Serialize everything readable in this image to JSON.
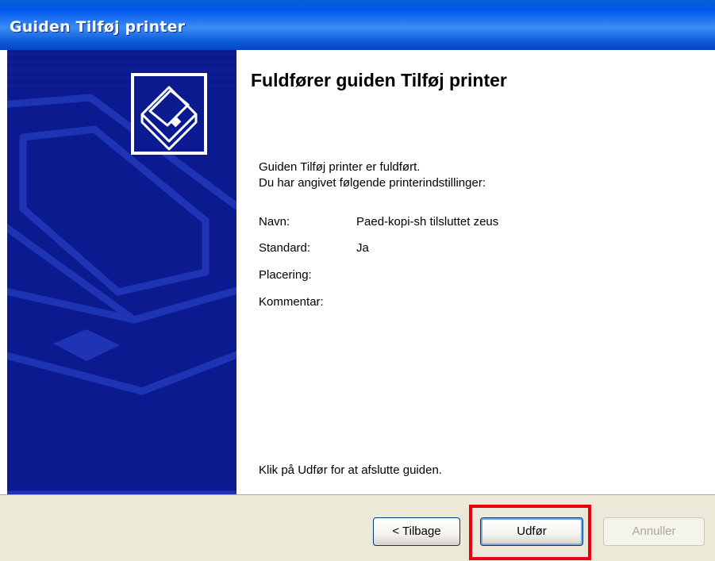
{
  "window": {
    "title": "Guiden Tilføj printer"
  },
  "heading": "Fuldfører guiden Tilføj printer",
  "intro": {
    "line1": "Guiden Tilføj printer er fuldført.",
    "line2": "Du har angivet følgende printerindstillinger:"
  },
  "settings": [
    {
      "label": "Navn:",
      "value": "Paed-kopi-sh tilsluttet zeus"
    },
    {
      "label": "Standard:",
      "value": "Ja"
    },
    {
      "label": "Placering:",
      "value": ""
    },
    {
      "label": "Kommentar:",
      "value": ""
    }
  ],
  "finish_hint": "Klik på Udfør for at afslutte guiden.",
  "buttons": {
    "back": "< Tilbage",
    "finish": "Udfør",
    "cancel": "Annuller"
  },
  "colors": {
    "side_panel": "#0b1a8f",
    "highlight": "#e8000f",
    "titlebar": "#0058ee"
  },
  "icons": [
    "printer-wizard-icon"
  ]
}
